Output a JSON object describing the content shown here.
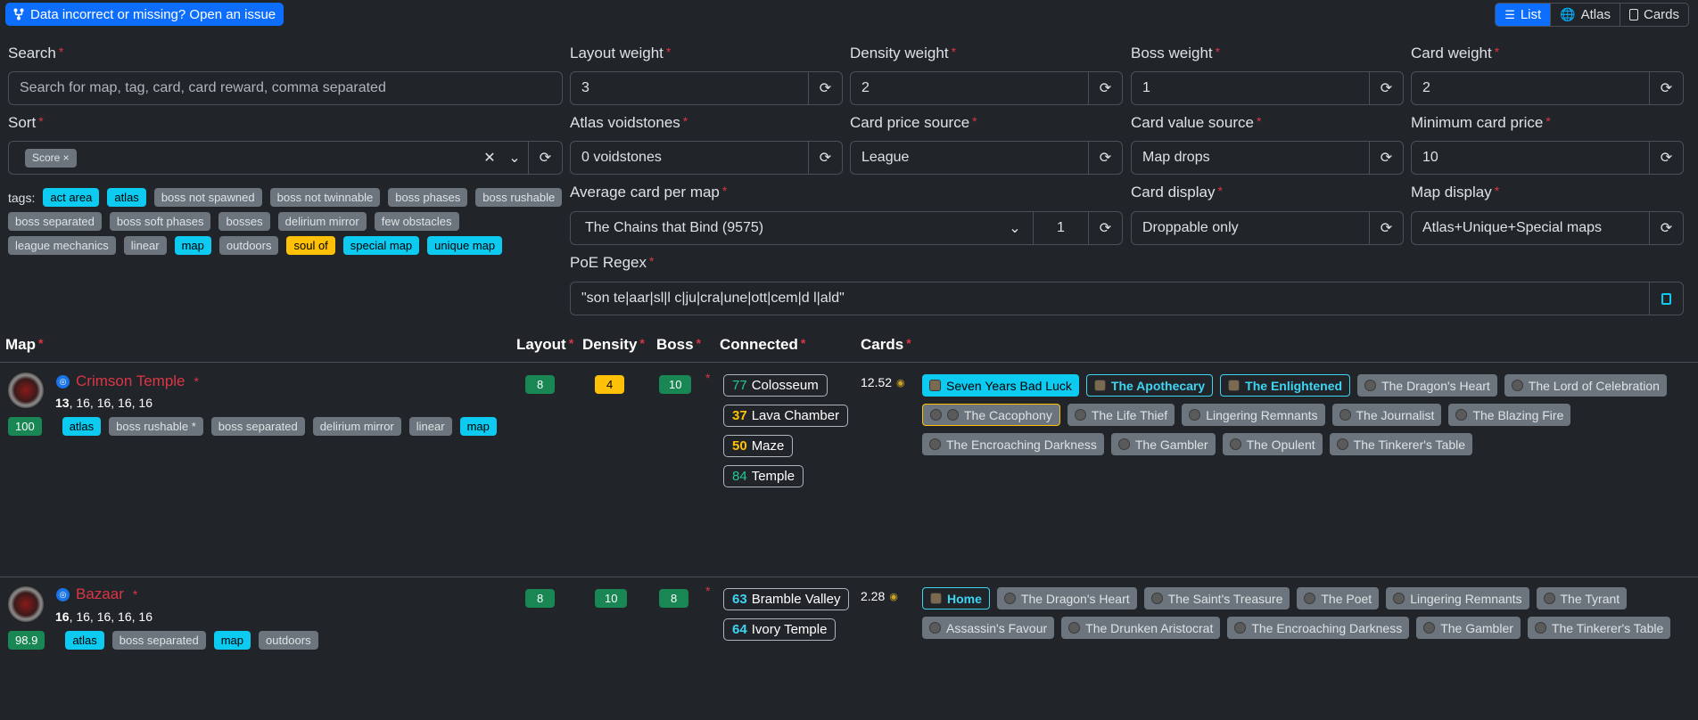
{
  "top": {
    "issue_label": "Data incorrect or missing? Open an issue",
    "views": [
      "List",
      "Atlas",
      "Cards"
    ],
    "active_view": "List"
  },
  "filters": {
    "search": {
      "label": "Search",
      "placeholder": "Search for map, tag, card, card reward, comma separated"
    },
    "layout_weight": {
      "label": "Layout weight",
      "value": "3"
    },
    "density_weight": {
      "label": "Density weight",
      "value": "2"
    },
    "boss_weight": {
      "label": "Boss weight",
      "value": "1"
    },
    "card_weight": {
      "label": "Card weight",
      "value": "2"
    },
    "sort": {
      "label": "Sort",
      "chip": "Score ×"
    },
    "atlas_voidstones": {
      "label": "Atlas voidstones",
      "value": "0 voidstones"
    },
    "card_price_source": {
      "label": "Card price source",
      "value": "League"
    },
    "card_value_source": {
      "label": "Card value source",
      "value": "Map drops"
    },
    "minimum_card_price": {
      "label": "Minimum card price",
      "value": "10"
    },
    "average_card": {
      "label": "Average card per map",
      "value": "The Chains that Bind (9575)",
      "count": "1"
    },
    "card_display": {
      "label": "Card display",
      "value": "Droppable only"
    },
    "map_display": {
      "label": "Map display",
      "value": "Atlas+Unique+Special maps"
    },
    "regex": {
      "label": "PoE Regex",
      "value": "\"son te|aar|sl|l c|ju|cra|une|ott|cem|d l|ald\""
    }
  },
  "tags": {
    "label": "tags:",
    "items": [
      {
        "text": "act area",
        "style": "info"
      },
      {
        "text": "atlas",
        "style": "info"
      },
      {
        "text": "boss not spawned",
        "style": "sec"
      },
      {
        "text": "boss not twinnable",
        "style": "sec"
      },
      {
        "text": "boss phases",
        "style": "sec"
      },
      {
        "text": "boss rushable",
        "style": "sec"
      },
      {
        "text": "boss separated",
        "style": "sec"
      },
      {
        "text": "boss soft phases",
        "style": "sec"
      },
      {
        "text": "bosses",
        "style": "sec"
      },
      {
        "text": "delirium mirror",
        "style": "sec"
      },
      {
        "text": "few obstacles",
        "style": "sec"
      },
      {
        "text": "league mechanics",
        "style": "sec"
      },
      {
        "text": "linear",
        "style": "sec"
      },
      {
        "text": "map",
        "style": "info"
      },
      {
        "text": "outdoors",
        "style": "sec"
      },
      {
        "text": "soul of",
        "style": "warn"
      },
      {
        "text": "special map",
        "style": "info"
      },
      {
        "text": "unique map",
        "style": "info"
      }
    ]
  },
  "table": {
    "headers": {
      "map": "Map",
      "layout": "Layout",
      "density": "Density",
      "boss": "Boss",
      "connected": "Connected",
      "cards": "Cards"
    },
    "rows": [
      {
        "name": "Crimson Temple",
        "tiers": "13, 16, 16, 16, 16",
        "tiers_first": "13",
        "tiers_rest": ", 16, 16, 16, 16",
        "score": "100",
        "tags": [
          {
            "text": "atlas",
            "style": "info"
          },
          {
            "text": "boss rushable *",
            "style": "sec"
          },
          {
            "text": "boss separated",
            "style": "sec"
          },
          {
            "text": "delirium mirror",
            "style": "sec"
          },
          {
            "text": "linear",
            "style": "sec"
          },
          {
            "text": "map",
            "style": "info"
          }
        ],
        "layout": "8",
        "layout_style": "succ",
        "density": "4",
        "density_style": "warn",
        "boss": "10",
        "boss_style": "succ",
        "connected": [
          {
            "num": "77",
            "name": "Colosseum",
            "color": "green"
          },
          {
            "num": "37",
            "name": "Lava Chamber",
            "color": "gold"
          },
          {
            "num": "50",
            "name": "Maze",
            "color": "gold"
          },
          {
            "num": "84",
            "name": "Temple",
            "color": "green"
          }
        ],
        "card_value": "12.52",
        "cards": [
          {
            "name": "Seven Years Bad Luck",
            "style": "info"
          },
          {
            "name": "The Apothecary",
            "style": "out"
          },
          {
            "name": "The Enlightened",
            "style": "out"
          },
          {
            "name": "The Dragon's Heart",
            "style": "sec"
          },
          {
            "name": "The Lord of Celebration",
            "style": "sec"
          },
          {
            "name": "The Cacophony",
            "style": "gold"
          },
          {
            "name": "The Life Thief",
            "style": "sec"
          },
          {
            "name": "Lingering Remnants",
            "style": "sec"
          },
          {
            "name": "The Journalist",
            "style": "sec"
          },
          {
            "name": "The Blazing Fire",
            "style": "sec"
          },
          {
            "name": "The Encroaching Darkness",
            "style": "sec"
          },
          {
            "name": "The Gambler",
            "style": "sec"
          },
          {
            "name": "The Opulent",
            "style": "sec"
          },
          {
            "name": "The Tinkerer's Table",
            "style": "sec"
          }
        ]
      },
      {
        "name": "Bazaar",
        "tiers": "16, 16, 16, 16, 16",
        "tiers_first": "16",
        "tiers_rest": ", 16, 16, 16, 16",
        "score": "98.9",
        "tags": [
          {
            "text": "atlas",
            "style": "info"
          },
          {
            "text": "boss separated",
            "style": "sec"
          },
          {
            "text": "map",
            "style": "info"
          },
          {
            "text": "outdoors",
            "style": "sec"
          }
        ],
        "layout": "8",
        "layout_style": "succ",
        "density": "10",
        "density_style": "succ",
        "boss": "8",
        "boss_style": "succ",
        "connected": [
          {
            "num": "63",
            "name": "Bramble Valley",
            "color": "blue"
          },
          {
            "num": "64",
            "name": "Ivory Temple",
            "color": "blue"
          }
        ],
        "card_value": "2.28",
        "cards": [
          {
            "name": "Home",
            "style": "out"
          },
          {
            "name": "The Dragon's Heart",
            "style": "sec"
          },
          {
            "name": "The Saint's Treasure",
            "style": "sec"
          },
          {
            "name": "The Poet",
            "style": "sec"
          },
          {
            "name": "Lingering Remnants",
            "style": "sec"
          },
          {
            "name": "The Tyrant",
            "style": "sec"
          },
          {
            "name": "Assassin's Favour",
            "style": "sec"
          },
          {
            "name": "The Drunken Aristocrat",
            "style": "sec"
          },
          {
            "name": "The Encroaching Darkness",
            "style": "sec"
          },
          {
            "name": "The Gambler",
            "style": "sec"
          },
          {
            "name": "The Tinkerer's Table",
            "style": "sec"
          }
        ]
      }
    ]
  }
}
